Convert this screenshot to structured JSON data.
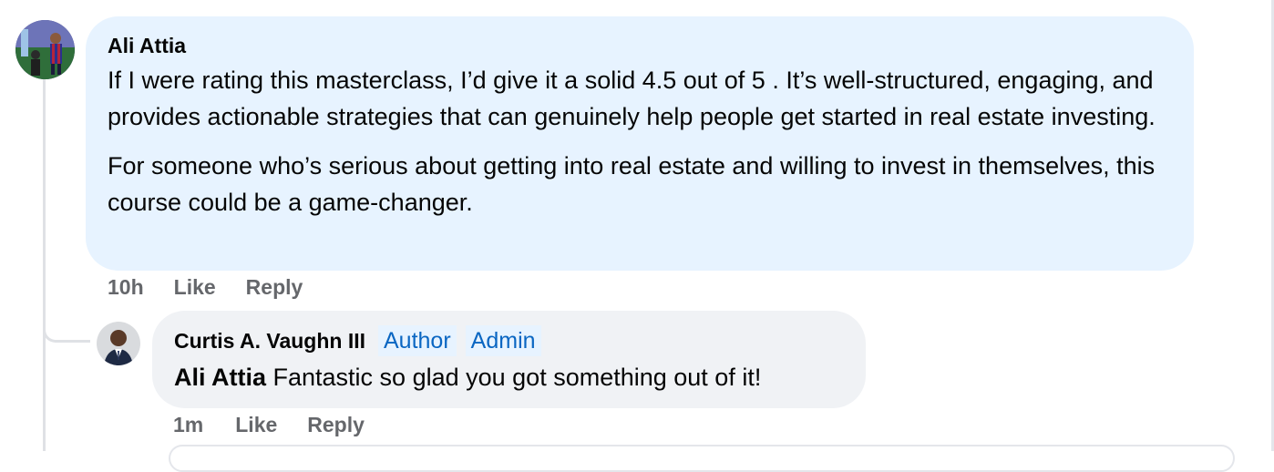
{
  "comment": {
    "author": "Ali Attia",
    "paragraphs": [
      "If I were rating this masterclass, I’d give it a solid 4.5 out of 5 . It’s well-structured, engaging, and provides actionable strategies that can genuinely help people get started in real estate investing.",
      "For someone who’s serious about getting into real estate and willing to invest in themselves, this course could be a game-changer."
    ],
    "time": "10h",
    "like_label": "Like",
    "reply_label": "Reply"
  },
  "reply": {
    "author": "Curtis A. Vaughn III",
    "badges": [
      "Author",
      "Admin"
    ],
    "mention": "Ali Attia",
    "text": "Fantastic so glad you got something out of it!",
    "time": "1m",
    "like_label": "Like",
    "reply_label": "Reply"
  },
  "colors": {
    "main_bubble": "#e7f3ff",
    "reply_bubble": "#f0f2f5",
    "badge_text": "#0a66c2",
    "meta_text": "#65676b"
  }
}
